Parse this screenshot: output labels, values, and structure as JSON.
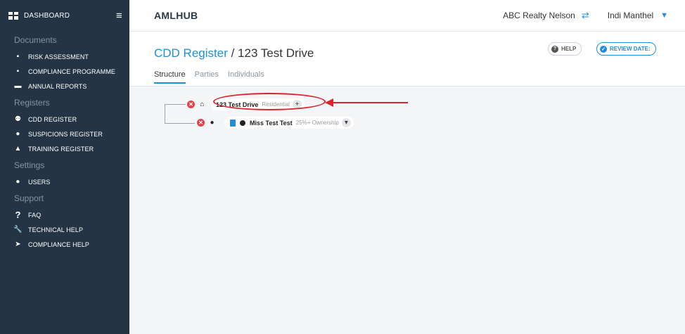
{
  "sidebar": {
    "dashboard_label": "DASHBOARD",
    "sections": {
      "documents": "Documents",
      "registers": "Registers",
      "settings": "Settings",
      "support": "Support"
    },
    "items": {
      "risk_assessment": "RISK ASSESSMENT",
      "compliance_programme": "COMPLIANCE PROGRAMME",
      "annual_reports": "ANNUAL REPORTS",
      "cdd_register": "CDD REGISTER",
      "suspicions_register": "SUSPICIONS REGISTER",
      "training_register": "TRAINING REGISTER",
      "users": "USERS",
      "faq": "FAQ",
      "technical_help": "TECHNICAL HELP",
      "compliance_help": "COMPLIANCE HELP"
    }
  },
  "topbar": {
    "logo_aml": "AML",
    "logo_hub": "HUB",
    "org_name": "ABC Realty Nelson",
    "user_name": "Indi Manthel"
  },
  "header": {
    "breadcrumb": "CDD Register",
    "separator": " / ",
    "page_title": "123 Test Drive",
    "help_label": "HELP",
    "review_label": "REVIEW DATE:"
  },
  "tabs": {
    "structure": "Structure",
    "parties": "Parties",
    "individuals": "Individuals"
  },
  "tree": {
    "root": {
      "name": "123 Test Drive",
      "type": "Residential"
    },
    "child": {
      "name": "Miss Test Test",
      "role": "25%+ Ownership"
    }
  },
  "colors": {
    "sidebar_bg": "#253445",
    "accent": "#1f8fd8",
    "danger": "#e2434b",
    "annotation": "#d9252b"
  }
}
